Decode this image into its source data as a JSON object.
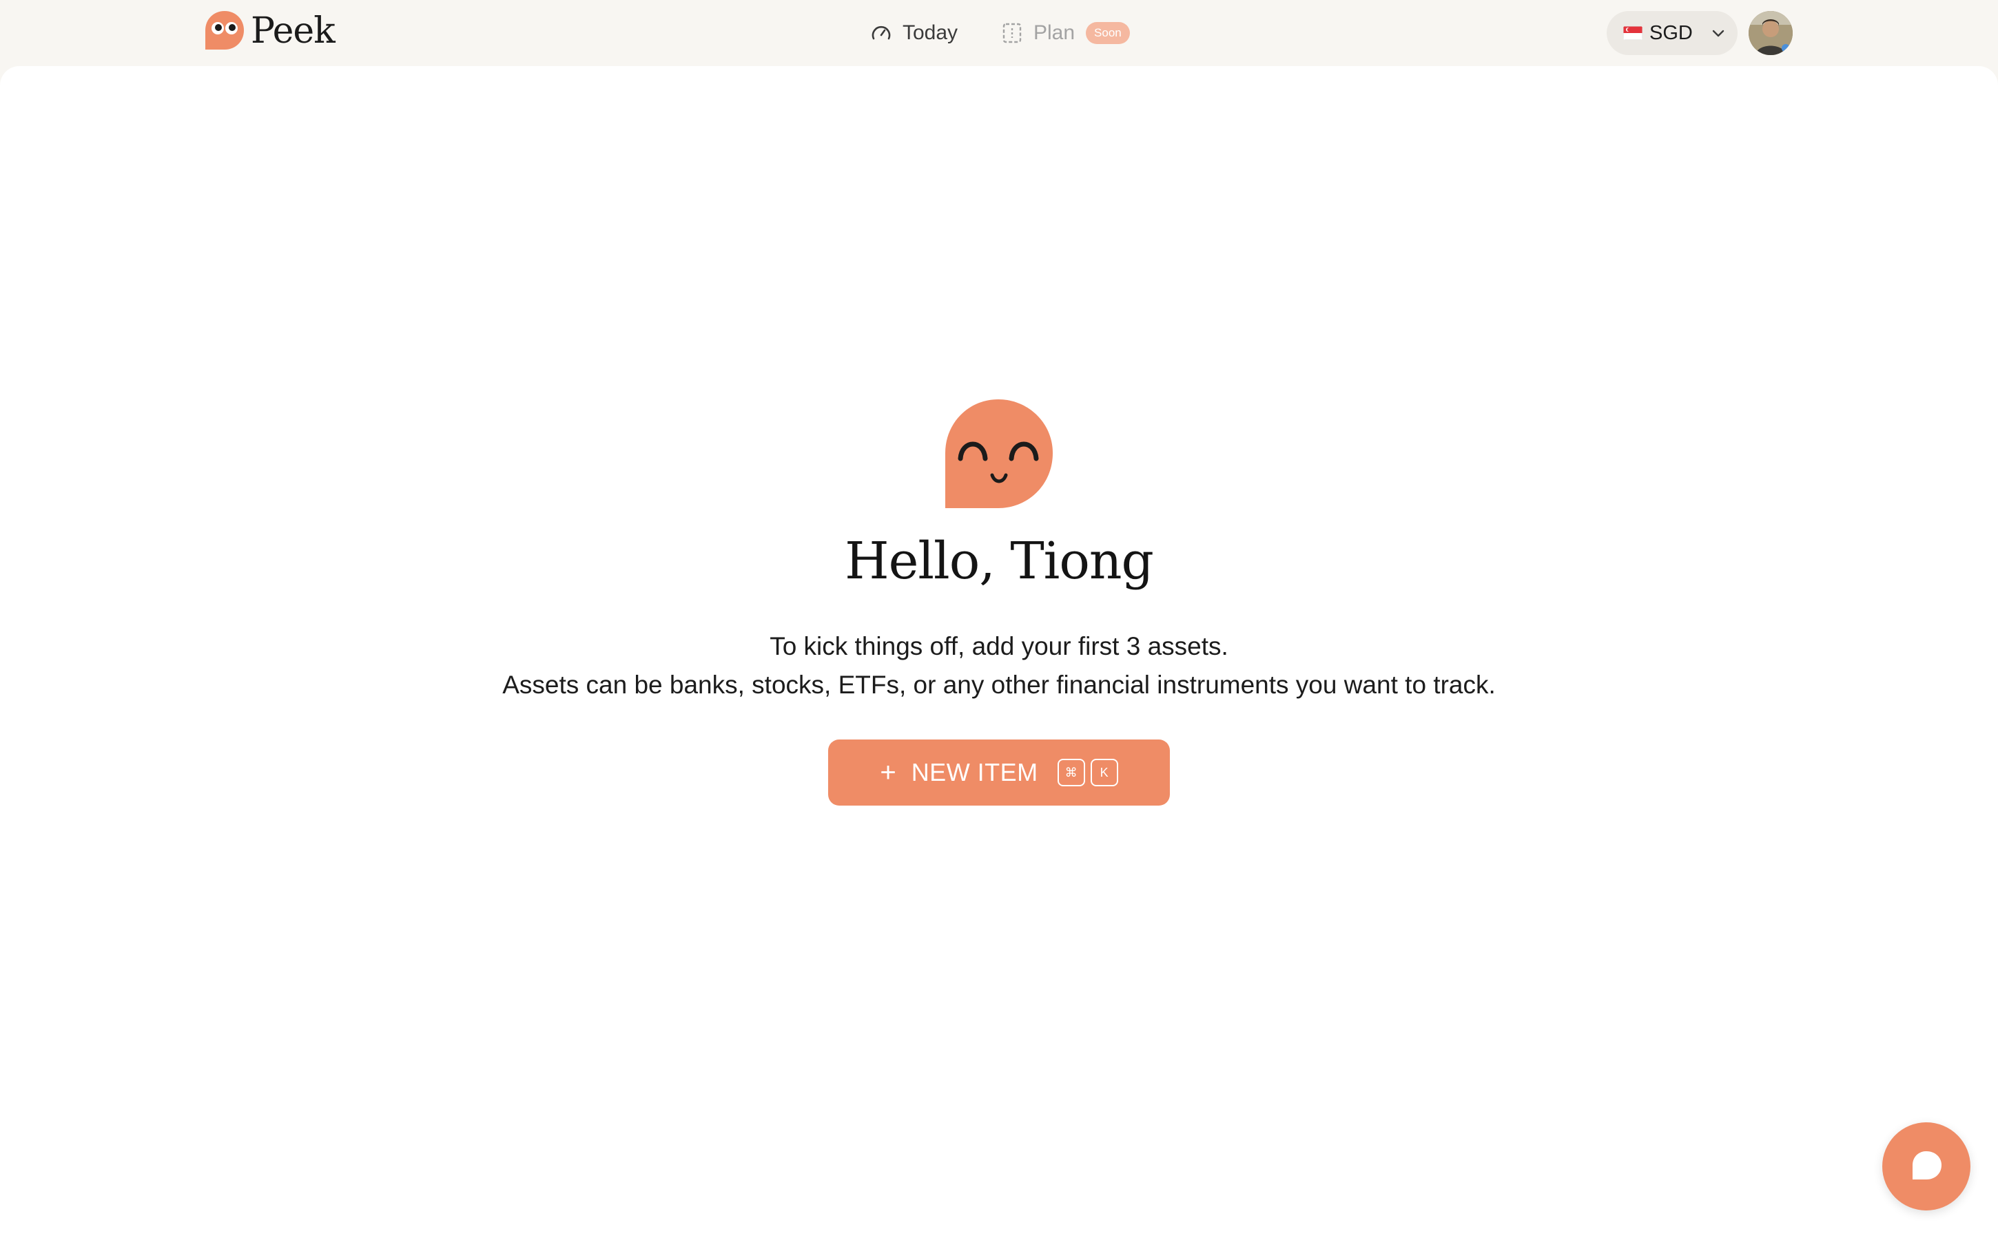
{
  "header": {
    "logo_text": "Peek",
    "nav": {
      "today_label": "Today",
      "plan_label": "Plan",
      "plan_badge": "Soon"
    },
    "currency": {
      "code": "SGD",
      "flag_icon": "singapore-flag-icon"
    },
    "avatar_icon": "user-avatar"
  },
  "main": {
    "greeting": "Hello, Tiong",
    "intro_line_1": "To kick things off, add your first 3 assets.",
    "intro_line_2": "Assets can be banks, stocks, ETFs, or any other financial instruments you want to track.",
    "new_item_button": {
      "icon": "plus-icon",
      "label": "NEW ITEM",
      "shortcut_keys": [
        "⌘",
        "K"
      ]
    }
  },
  "chat_button": {
    "icon": "chat-bubble-icon"
  },
  "colors": {
    "accent": "#ef8c66",
    "header_bg": "#f8f6f2",
    "card_bg": "#ffffff",
    "badge": "#f5b8a0"
  }
}
